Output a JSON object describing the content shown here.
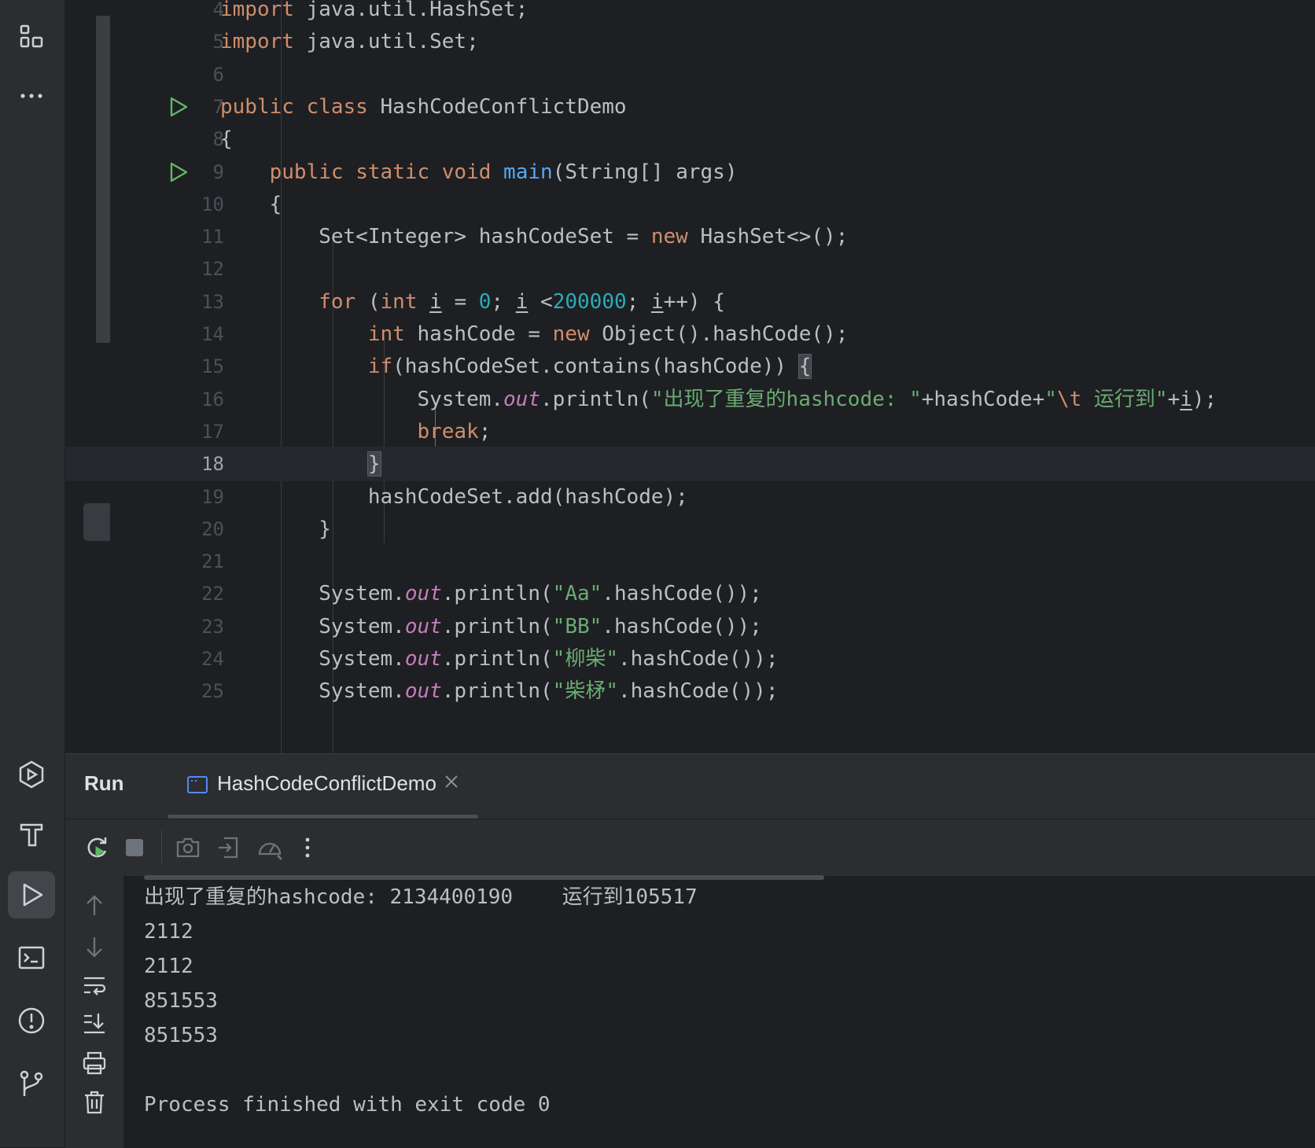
{
  "editor": {
    "lines": [
      {
        "num": "4",
        "html": "<span class=\"kw\">import</span> java.util.HashSet;"
      },
      {
        "num": "5",
        "html": "<span class=\"kw\">import</span> java.util.Set;"
      },
      {
        "num": "6",
        "html": ""
      },
      {
        "num": "7",
        "html": "<span class=\"kw\">public class</span> HashCodeConflictDemo",
        "run": true
      },
      {
        "num": "8",
        "html": "{"
      },
      {
        "num": "9",
        "html": "    <span class=\"kw\">public static void</span> <span class=\"fn\">main</span>(String[] args)",
        "run": true
      },
      {
        "num": "10",
        "html": "    {"
      },
      {
        "num": "11",
        "html": "        Set&lt;Integer&gt; hashCodeSet = <span class=\"kw\">new</span> HashSet&lt;&gt;();"
      },
      {
        "num": "12",
        "html": ""
      },
      {
        "num": "13",
        "html": "        <span class=\"kw\">for</span> (<span class=\"kw\">int</span> <span class=\"ul\">i</span> = <span class=\"num\">0</span>; <span class=\"ul\">i</span> &lt;<span class=\"num\">200000</span>; <span class=\"ul\">i</span>++) {"
      },
      {
        "num": "14",
        "html": "            <span class=\"kw\">int</span> hashCode = <span class=\"kw\">new</span> Object().hashCode();"
      },
      {
        "num": "15",
        "html": "            <span class=\"kw\">if</span>(hashCodeSet.contains(hashCode)) <span class=\"brace-hl\">{</span>"
      },
      {
        "num": "16",
        "html": "                System.<span class=\"field\">out</span>.println(<span class=\"str\">\"出现了重复的hashcode: \"</span>+hashCode+<span class=\"str\">\"</span><span class=\"esc\">\\t</span><span class=\"str\"> 运行到\"</span>+<span class=\"ul\">i</span>);"
      },
      {
        "num": "17",
        "html": "                <span class=\"kw\">break</span>;"
      },
      {
        "num": "18",
        "html": "            <span class=\"brace-hl\">}</span>",
        "current": true
      },
      {
        "num": "19",
        "html": "            hashCodeSet.add(hashCode);"
      },
      {
        "num": "20",
        "html": "        }"
      },
      {
        "num": "21",
        "html": ""
      },
      {
        "num": "22",
        "html": "        System.<span class=\"field\">out</span>.println(<span class=\"str\">\"Aa\"</span>.hashCode());"
      },
      {
        "num": "23",
        "html": "        System.<span class=\"field\">out</span>.println(<span class=\"str\">\"BB\"</span>.hashCode());"
      },
      {
        "num": "24",
        "html": "        System.<span class=\"field\">out</span>.println(<span class=\"str\">\"柳柴\"</span>.hashCode());"
      },
      {
        "num": "25",
        "html": "        System.<span class=\"field\">out</span>.println(<span class=\"str\">\"柴柕\"</span>.hashCode());"
      }
    ]
  },
  "run": {
    "title": "Run",
    "tab_label": "HashCodeConflictDemo",
    "output": [
      "出现了重复的hashcode: 2134400190\t运行到105517",
      "2112",
      "2112",
      "851553",
      "851553",
      "",
      "Process finished with exit code 0"
    ]
  },
  "left_strip": {
    "top_icons": [
      "structure-icon",
      "more-icon"
    ],
    "bottom_icons": [
      "services-icon",
      "build-icon",
      "run-icon",
      "terminal-icon",
      "problems-icon",
      "git-icon"
    ],
    "active": "run-icon"
  },
  "colors": {
    "keyword": "#cf8e6d",
    "function": "#56a8f5",
    "number": "#2aacb8",
    "string": "#6aab73",
    "field": "#c77dbb",
    "run_green": "#5fb865"
  }
}
